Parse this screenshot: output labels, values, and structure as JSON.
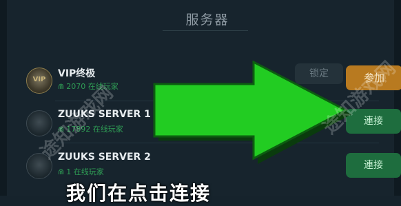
{
  "header": {
    "title": "服务器"
  },
  "servers": [
    {
      "name": "VIP终极",
      "online": "2070 在线玩家",
      "icon": "vip-badge-icon",
      "icon_text": "VIP",
      "buttons": [
        {
          "label": "锁定",
          "type": "locked"
        },
        {
          "label": "参加",
          "type": "join"
        }
      ]
    },
    {
      "name": "ZUUKS SERVER 1",
      "online": "17892 在线玩家",
      "icon": "server-badge-icon",
      "buttons": [
        {
          "label": "連接",
          "type": "connect"
        }
      ]
    },
    {
      "name": "ZUUKS SERVER 2",
      "online": "1 在线玩家",
      "icon": "server-badge-icon",
      "buttons": [
        {
          "label": "連接",
          "type": "connect"
        }
      ]
    }
  ],
  "overlay": {
    "subtitle": "我们在点击连接",
    "watermark_left": "途知游戏网",
    "watermark_right": "途知游戏网",
    "arrow_color": "#22cc22"
  },
  "colors": {
    "background": "#17242d",
    "online_text": "#2f9d55",
    "join_button": "#b87a20",
    "connect_button": "#1e6d3e"
  }
}
